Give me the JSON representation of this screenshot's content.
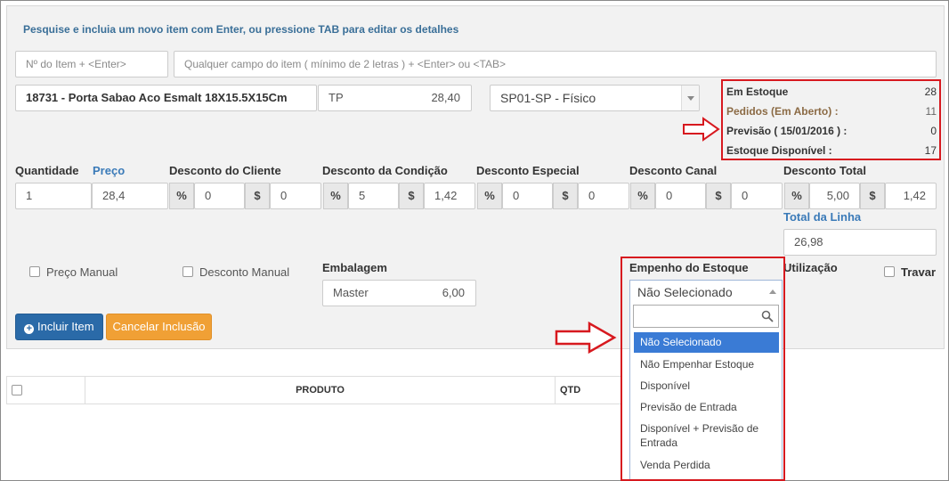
{
  "hint": "Pesquise e incluia um novo item com Enter, ou pressione TAB para editar os detalhes",
  "search": {
    "item_no_placeholder": "Nº do Item + <Enter>",
    "any_field_placeholder": "Qualquer campo do item ( mínimo de 2 letras ) + <Enter> ou <TAB>"
  },
  "item": {
    "description": "18731 - Porta Sabao Aco Esmalt 18X15.5X15Cm",
    "price_table": "TP",
    "price_table_value": "28,40",
    "warehouse": "SP01-SP - Físico"
  },
  "stock": {
    "em_estoque_label": "Em Estoque",
    "em_estoque_value": "28",
    "pedidos_label": "Pedidos (Em Aberto) :",
    "pedidos_value": "11",
    "previsao_label": "Previsão ( 15/01/2016 ) :",
    "previsao_value": "0",
    "disponivel_label": "Estoque Disponível :",
    "disponivel_value": "17"
  },
  "labels": {
    "quantidade": "Quantidade",
    "preco": "Preço",
    "desc_cliente": "Desconto do Cliente",
    "desc_condicao": "Desconto da Condição",
    "desc_especial": "Desconto Especial",
    "desc_canal": "Desconto Canal",
    "desc_total": "Desconto Total",
    "total_linha": "Total da Linha",
    "embalagem": "Embalagem",
    "empenho": "Empenho do Estoque",
    "utilizacao": "Utilização",
    "travar": "Travar",
    "preco_manual": "Preço Manual",
    "desconto_manual": "Desconto Manual",
    "pct": "%",
    "dollar": "$"
  },
  "values": {
    "quantidade": "1",
    "preco": "28,4",
    "cliente_pct": "0",
    "cliente_val": "0",
    "condicao_pct": "5",
    "condicao_val": "1,42",
    "especial_pct": "0",
    "especial_val": "0",
    "canal_pct": "0",
    "canal_val": "0",
    "total_pct": "5,00",
    "total_val": "1,42",
    "total_linha": "26,98",
    "embalagem_nome": "Master",
    "embalagem_qtd": "6,00"
  },
  "empenho": {
    "selected": "Não Selecionado",
    "options": [
      "Não Selecionado",
      "Não Empenhar Estoque",
      "Disponível",
      "Previsão de Entrada",
      "Disponível + Previsão de Entrada",
      "Venda Perdida"
    ]
  },
  "buttons": {
    "incluir": "Incluir Item",
    "cancelar": "Cancelar Inclusão"
  },
  "table": {
    "produto": "PRODUTO",
    "qtd": "QTD"
  },
  "colors": {
    "highlight": "#d7191f",
    "primary_button": "#2a6aa8",
    "warning_button": "#f0a035",
    "selected_option": "#3a7bd5"
  }
}
